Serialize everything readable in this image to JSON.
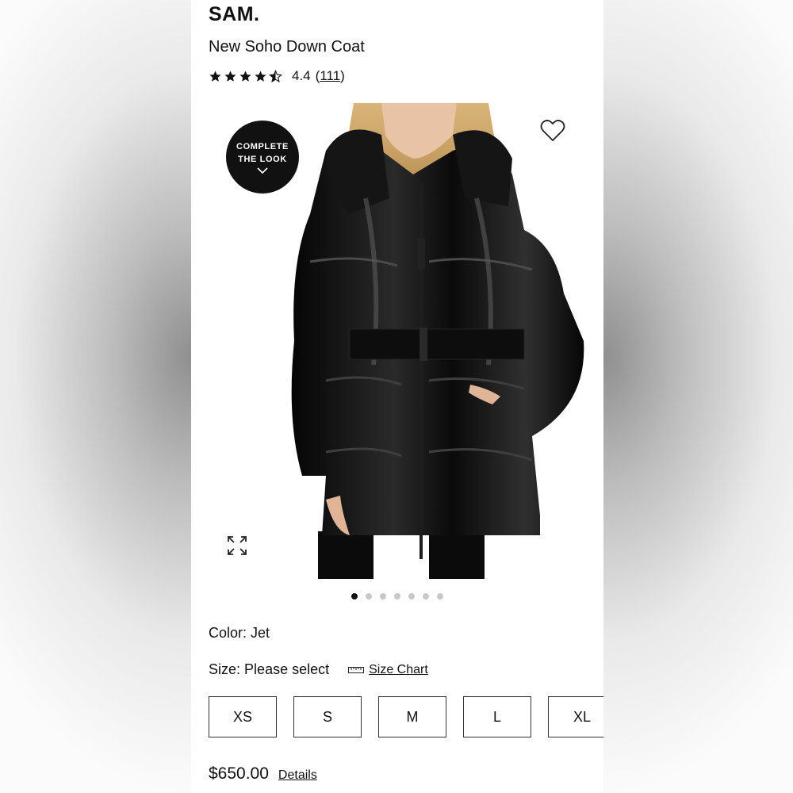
{
  "product": {
    "brand": "SAM.",
    "title": "New Soho Down Coat",
    "rating": "4.4",
    "review_count": "111",
    "stars_value": 4.4,
    "stars_max": 5
  },
  "image": {
    "complete_the_look_line1": "COMPLETE",
    "complete_the_look_line2": "THE LOOK",
    "favorite_icon": "heart-icon",
    "expand_icon": "expand-icon",
    "carousel_total": 7,
    "carousel_active": 1
  },
  "options": {
    "color_label": "Color:",
    "color_value": "Jet",
    "size_label": "Size:",
    "size_value": "Please select",
    "size_chart_label": "Size Chart",
    "sizes": [
      "XS",
      "S",
      "M",
      "L",
      "XL"
    ]
  },
  "pricing": {
    "price": "$650.00",
    "details_label": "Details"
  },
  "colors": {
    "text": "#111111",
    "coat": "#0c0c0c",
    "dot_inactive": "#c8c8c8"
  }
}
